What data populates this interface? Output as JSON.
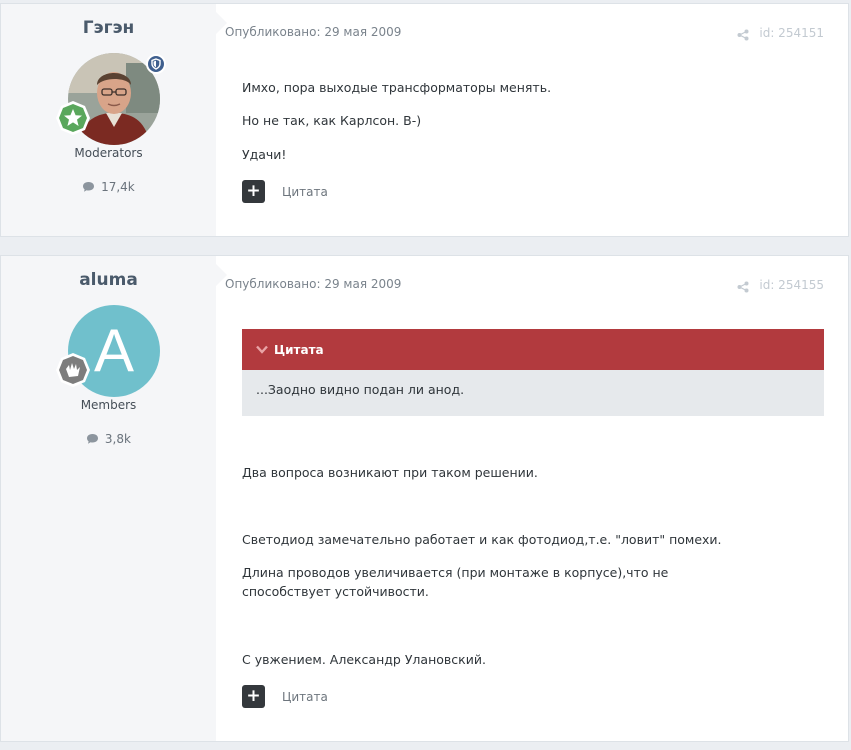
{
  "posts": [
    {
      "author": {
        "name": "Гэгэн",
        "group": "Moderators",
        "post_count": "17,4k",
        "avatar_type": "photo",
        "rank_badge_icon": "star-badge-icon",
        "role_badge_icon": "shield-badge-icon"
      },
      "published": "Опубликовано: 29 мая 2009",
      "id_label": "id: 254151",
      "paragraphs": [
        "Имхо, пора выходые трансформаторы менять.",
        "Но не так, как Карлсон. B-)",
        "Удачи!"
      ],
      "quote_action": "Цитата"
    },
    {
      "author": {
        "name": "aluma",
        "group": "Members",
        "post_count": "3,8k",
        "avatar_letter": "A",
        "rank_badge_icon": "hand-badge-icon"
      },
      "published": "Опубликовано: 29 мая 2009",
      "id_label": "id: 254155",
      "quote": {
        "header": "Цитата",
        "text": "...Заодно видно подан ли анод."
      },
      "paragraphs": [
        "Два вопроса возникают при таком решении.",
        "Светодиод замечательно работает и как фотодиод,т.е. \"ловит\" помехи.",
        "Длина проводов увеличивается (при монтаже в корпусе),что не способствует устойчивости.",
        "С увжением. Александр Улановский."
      ],
      "quote_action": "Цитата"
    }
  ],
  "colors": {
    "page_bg": "#ebeef2",
    "quote_header": "#b23a3e",
    "quote_body": "#e6e9ec",
    "author_panel": "#f5f6f8"
  }
}
